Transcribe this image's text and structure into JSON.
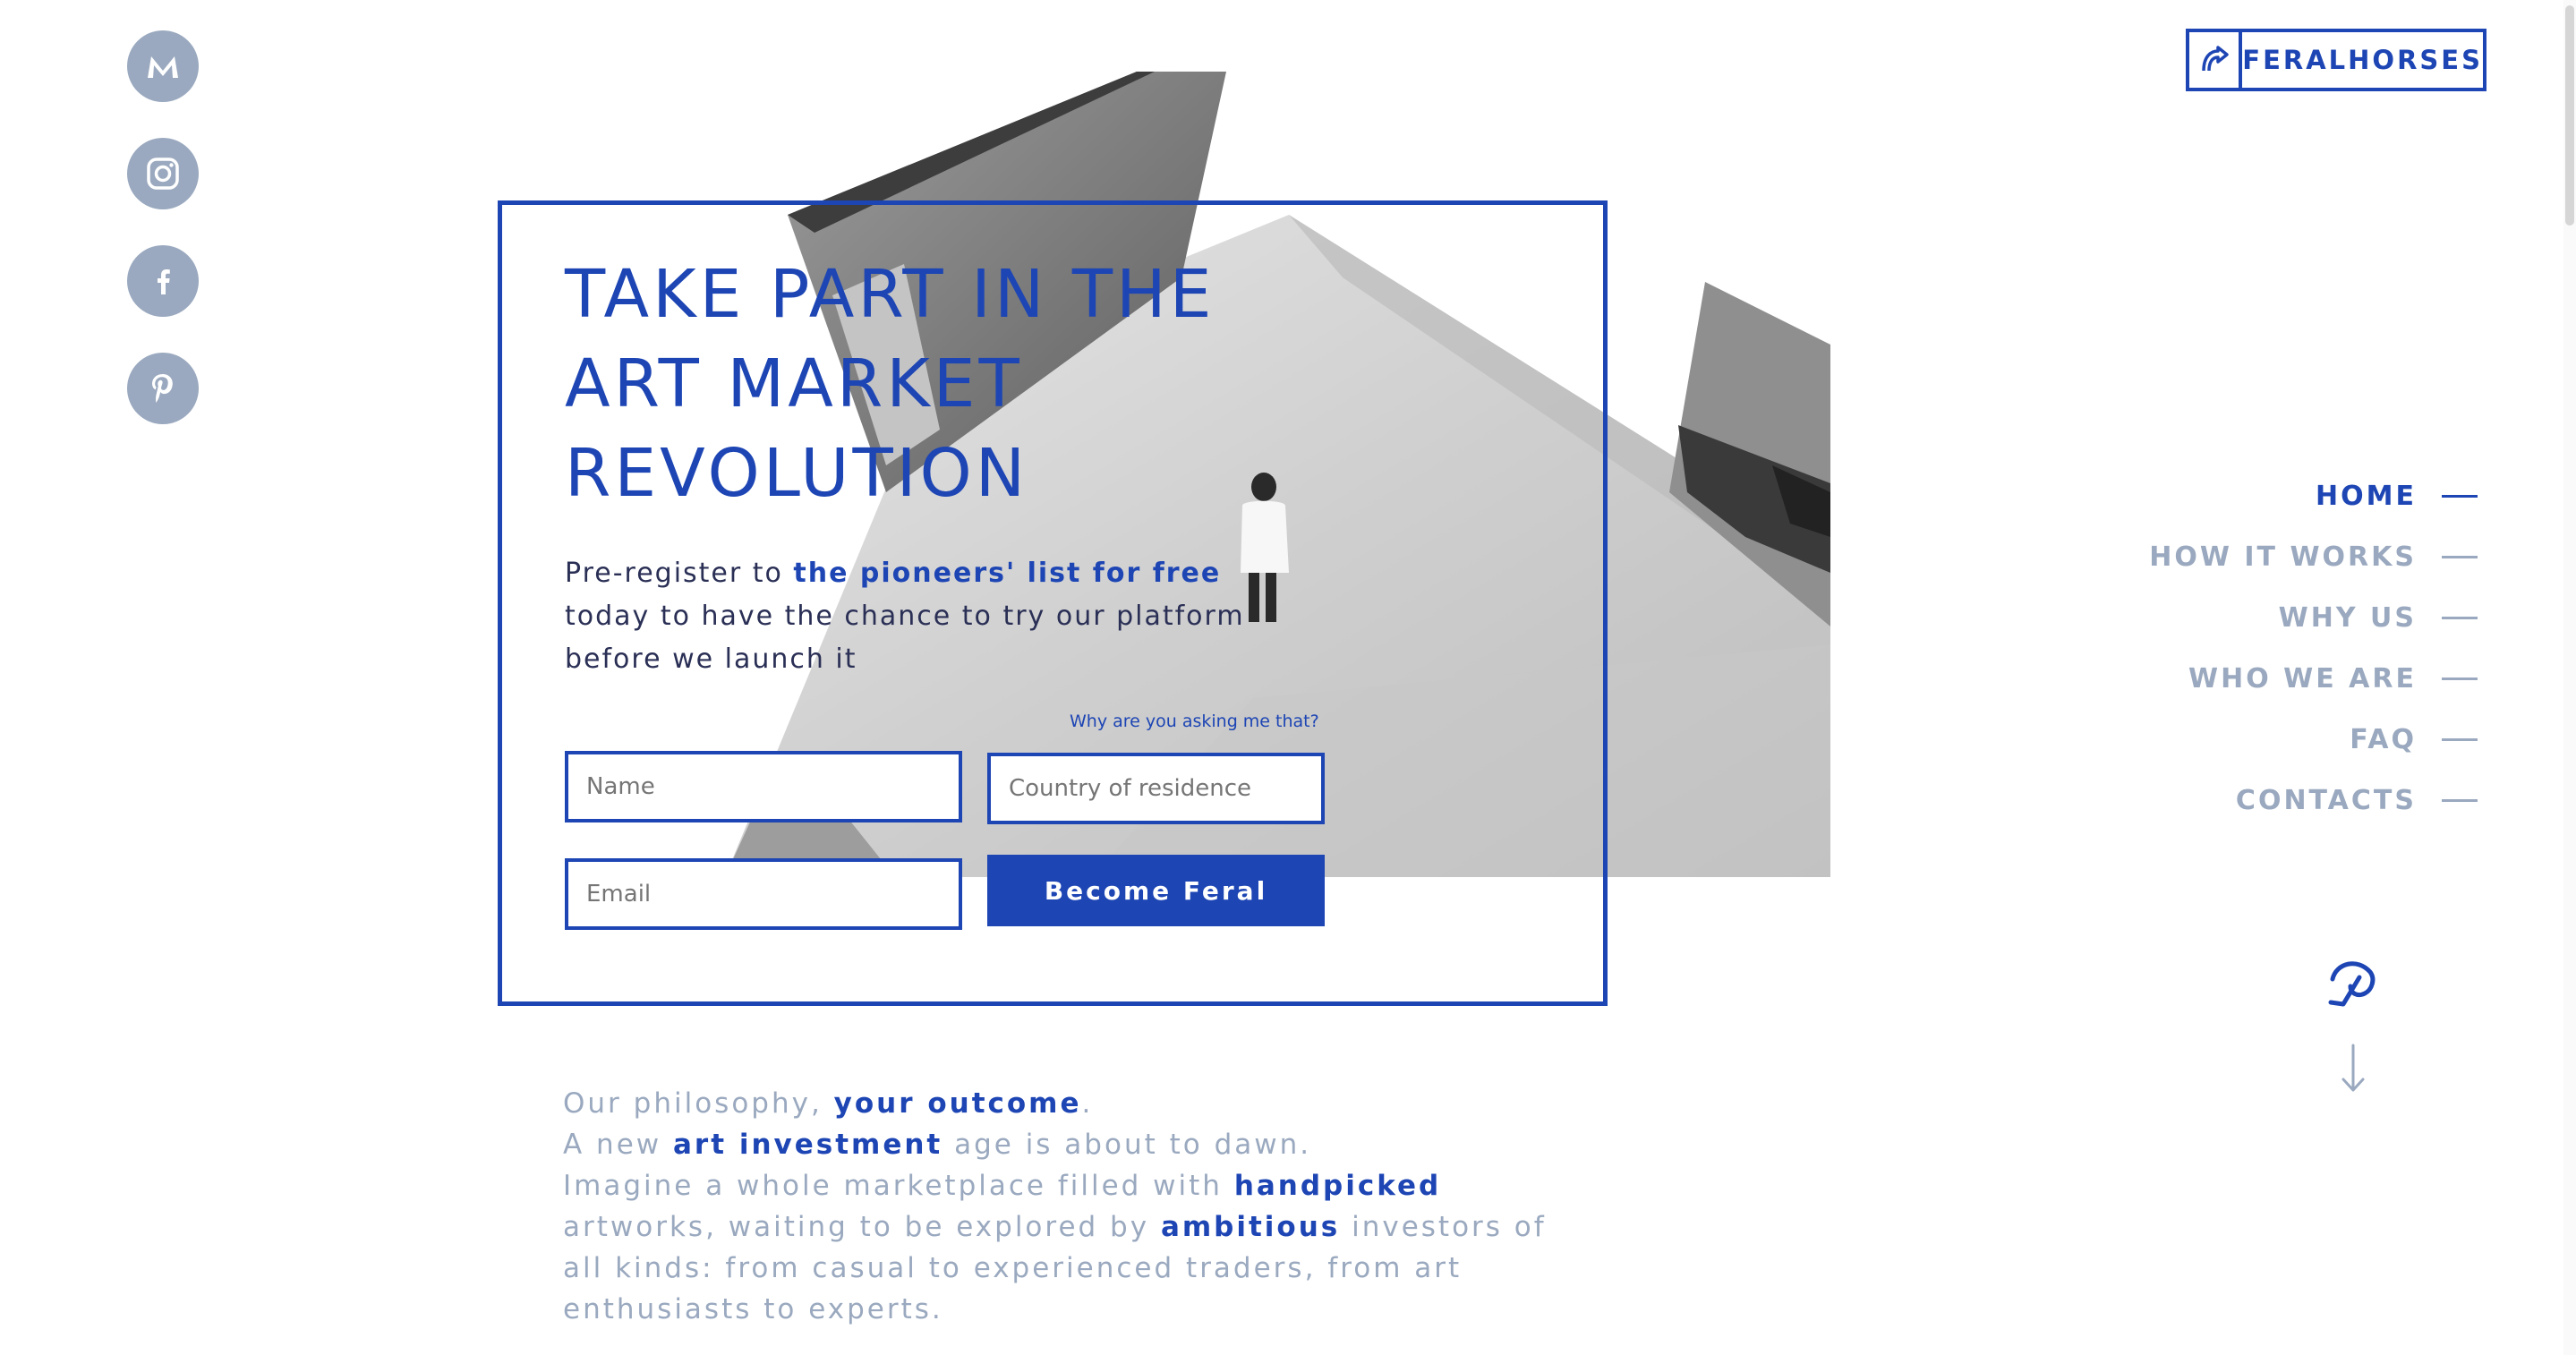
{
  "brand": {
    "name": "FERALHORSES"
  },
  "social": [
    {
      "name": "medium-icon"
    },
    {
      "name": "instagram-icon"
    },
    {
      "name": "facebook-icon"
    },
    {
      "name": "pinterest-icon"
    }
  ],
  "colors": {
    "accent": "#1d45b4",
    "muted": "#9aa9bf",
    "text": "#2a2f55"
  },
  "hero": {
    "title_lines": [
      "TAKE PART IN THE",
      "ART MARKET",
      "REVOLUTION"
    ],
    "sub_before": "Pre-register to ",
    "sub_highlight": "the pioneers' list for free",
    "sub_after": " today to have the chance to try our platform before we launch it",
    "why_link": "Why are you asking me that?",
    "name_placeholder": "Name",
    "country_placeholder": "Country of residence",
    "email_placeholder": "Email",
    "cta_label": "Become Feral"
  },
  "nav": {
    "items": [
      {
        "label": "HOME",
        "active": true
      },
      {
        "label": "HOW IT WORKS",
        "active": false
      },
      {
        "label": "WHY US",
        "active": false
      },
      {
        "label": "WHO WE ARE",
        "active": false
      },
      {
        "label": "FAQ",
        "active": false
      },
      {
        "label": "CONTACTS",
        "active": false
      }
    ]
  },
  "philosophy": {
    "l1_a": "Our philosophy, ",
    "l1_b": "your outcome",
    "l1_c": ".",
    "l2_a": "A new ",
    "l2_b": "art investment",
    "l2_c": " age is about to dawn.",
    "l3_a": "Imagine a whole marketplace filled with ",
    "l3_b": "handpicked",
    "l3_c": " artworks, waiting to be explored by ",
    "l3_d": "ambitious",
    "l3_e": " investors of all kinds: from casual to experienced traders, from art enthusiasts to experts."
  }
}
